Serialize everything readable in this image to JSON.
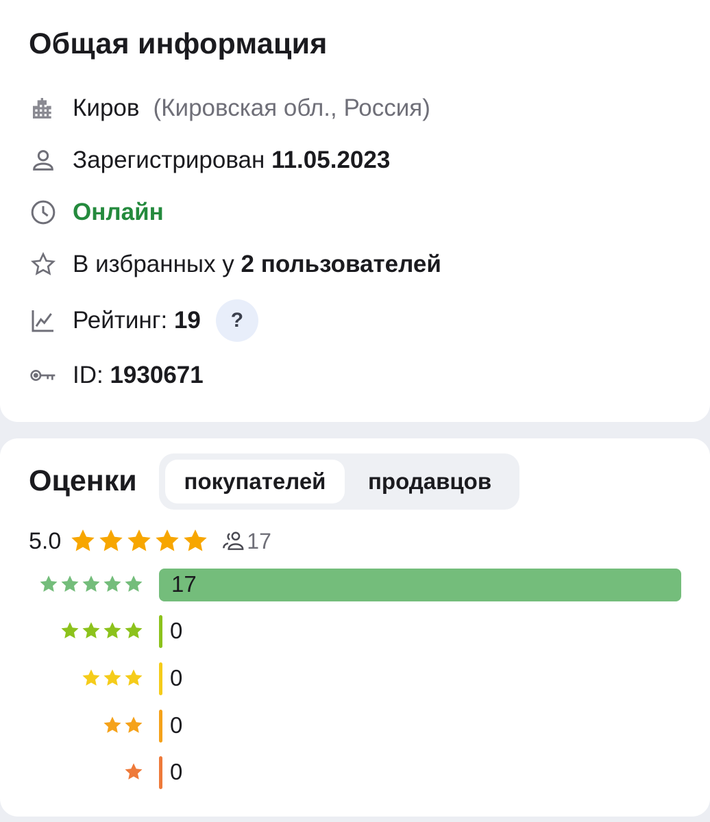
{
  "info": {
    "title": "Общая информация",
    "city": "Киров",
    "region": "(Кировская обл., Россия)",
    "registered_label": "Зарегистрирован",
    "registered_date": "11.05.2023",
    "status": "Онлайн",
    "favorites_prefix": "В избранных у",
    "favorites_value": "2 пользователей",
    "rating_label": "Рейтинг:",
    "rating_value": "19",
    "help_label": "?",
    "id_label": "ID:",
    "id_value": "1930671"
  },
  "ratings": {
    "title": "Оценки",
    "tabs": [
      {
        "label": "покупателей",
        "active": true
      },
      {
        "label": "продавцов",
        "active": false
      }
    ],
    "average": "5.0",
    "average_stars": 5,
    "reviewers_count": "17",
    "distribution": [
      {
        "stars": 5,
        "count": 17,
        "label": "17",
        "color": "#74bd7b"
      },
      {
        "stars": 4,
        "count": 0,
        "label": "0",
        "color": "#8cc21c"
      },
      {
        "stars": 3,
        "count": 0,
        "label": "0",
        "color": "#f5cc1a"
      },
      {
        "stars": 2,
        "count": 0,
        "label": "0",
        "color": "#f5a21a"
      },
      {
        "stars": 1,
        "count": 0,
        "label": "0",
        "color": "#ee7a3a"
      }
    ]
  },
  "colors": {
    "accent_green": "#248a3d",
    "star_gold": "#f7a600",
    "help_bg": "#e8eefa"
  },
  "icons": [
    "city-icon",
    "user-icon",
    "clock-icon",
    "star-outline-icon",
    "chart-icon",
    "key-icon",
    "users-icon",
    "star-icon"
  ]
}
